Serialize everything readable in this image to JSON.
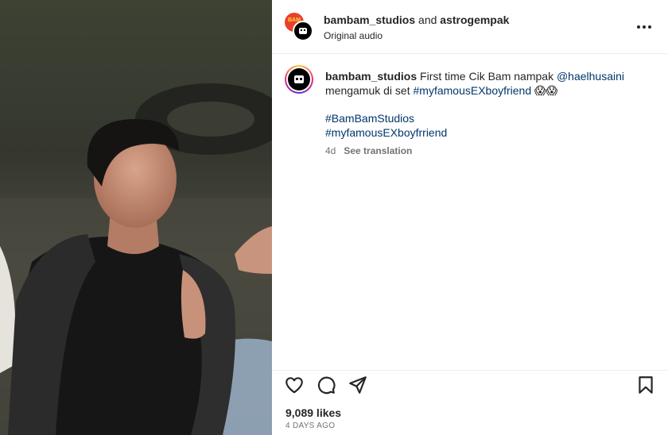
{
  "post": {
    "header": {
      "author": "bambam_studios",
      "connector": " and ",
      "coauthor": "astrogempak",
      "audio": "Original audio",
      "back_avatar_text": "BAM"
    },
    "caption": {
      "username": "bambam_studios",
      "text_part1": " First time Cik Bam nampak ",
      "mention": "@haelhusaini",
      "text_part2": " mengamuk di set ",
      "hashtag1": "#myfamousEXboyfriend",
      "emoji": " 😱😱",
      "hashtag2": "#BamBamStudios",
      "hashtag3": "#myfamousEXboyfrriend",
      "age": "4d",
      "see_translation": "See translation"
    },
    "likes": "9,089 likes",
    "date": "4 DAYS AGO"
  },
  "colors": {
    "link": "#00376b",
    "meta": "#737373",
    "text": "#262626",
    "divider": "#efefef"
  },
  "icons": {
    "like": "heart-icon",
    "comment": "comment-icon",
    "share": "send-icon",
    "save": "bookmark-icon",
    "more": "more-options-icon"
  }
}
